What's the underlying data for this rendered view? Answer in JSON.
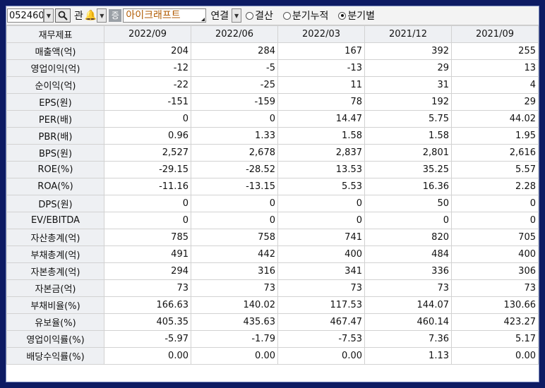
{
  "toolbar": {
    "stock_code": "052460",
    "kwan_label": "관",
    "jeung_label": "증",
    "company_name": "아이크래프트",
    "link_label": "연결",
    "radios": [
      {
        "label": "결산",
        "selected": false
      },
      {
        "label": "분기누적",
        "selected": false
      },
      {
        "label": "분기별",
        "selected": true
      }
    ]
  },
  "table": {
    "columns": [
      "재무제표",
      "2022/09",
      "2022/06",
      "2022/03",
      "2021/12",
      "2021/09"
    ],
    "rows": [
      {
        "label": "매출액(억)",
        "values": [
          "204",
          "284",
          "167",
          "392",
          "255"
        ]
      },
      {
        "label": "영업이익(억)",
        "values": [
          "-12",
          "-5",
          "-13",
          "29",
          "13"
        ]
      },
      {
        "label": "순이익(억)",
        "values": [
          "-22",
          "-25",
          "11",
          "31",
          "4"
        ]
      },
      {
        "label": "EPS(원)",
        "values": [
          "-151",
          "-159",
          "78",
          "192",
          "29"
        ]
      },
      {
        "label": "PER(배)",
        "values": [
          "0",
          "0",
          "14.47",
          "5.75",
          "44.02"
        ]
      },
      {
        "label": "PBR(배)",
        "values": [
          "0.96",
          "1.33",
          "1.58",
          "1.58",
          "1.95"
        ]
      },
      {
        "label": "BPS(원)",
        "values": [
          "2,527",
          "2,678",
          "2,837",
          "2,801",
          "2,616"
        ]
      },
      {
        "label": "ROE(%)",
        "values": [
          "-29.15",
          "-28.52",
          "13.53",
          "35.25",
          "5.57"
        ]
      },
      {
        "label": "ROA(%)",
        "values": [
          "-11.16",
          "-13.15",
          "5.53",
          "16.36",
          "2.28"
        ]
      },
      {
        "label": "DPS(원)",
        "values": [
          "0",
          "0",
          "0",
          "50",
          "0"
        ]
      },
      {
        "label": "EV/EBITDA",
        "values": [
          "0",
          "0",
          "0",
          "0",
          "0"
        ]
      },
      {
        "label": "자산총계(억)",
        "values": [
          "785",
          "758",
          "741",
          "820",
          "705"
        ]
      },
      {
        "label": "부채총계(억)",
        "values": [
          "491",
          "442",
          "400",
          "484",
          "400"
        ]
      },
      {
        "label": "자본총계(억)",
        "values": [
          "294",
          "316",
          "341",
          "336",
          "306"
        ]
      },
      {
        "label": "자본금(억)",
        "values": [
          "73",
          "73",
          "73",
          "73",
          "73"
        ]
      },
      {
        "label": "부채비율(%)",
        "values": [
          "166.63",
          "140.02",
          "117.53",
          "144.07",
          "130.66"
        ]
      },
      {
        "label": "유보율(%)",
        "values": [
          "405.35",
          "435.63",
          "467.47",
          "460.14",
          "423.27"
        ]
      },
      {
        "label": "영업이익률(%)",
        "values": [
          "-5.97",
          "-1.79",
          "-7.53",
          "7.36",
          "5.17"
        ]
      },
      {
        "label": "배당수익률(%)",
        "values": [
          "0.00",
          "0.00",
          "0.00",
          "1.13",
          "0.00"
        ]
      }
    ]
  },
  "icons": {
    "search": "search-icon",
    "bell": "bell-icon",
    "dropdown": "chevron-down-icon"
  }
}
